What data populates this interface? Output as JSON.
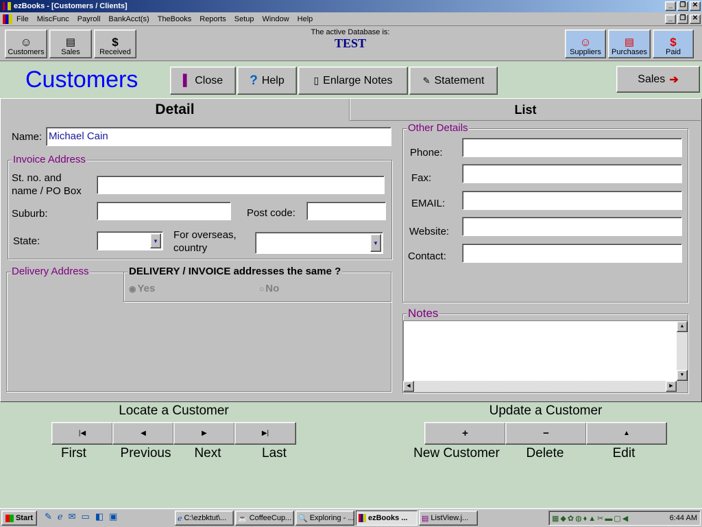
{
  "window": {
    "title": "ezBooks - [Customers / Clients]"
  },
  "menu": [
    "File",
    "MiscFunc",
    "Payroll",
    "BankAcct(s)",
    "TheBooks",
    "Reports",
    "Setup",
    "Window",
    "Help"
  ],
  "toolbar": {
    "left": [
      {
        "label": "Customers",
        "icon": "smiley-icon"
      },
      {
        "label": "Sales",
        "icon": "pages-icon"
      },
      {
        "label": "Received",
        "icon": "dollar-icon"
      }
    ],
    "db_label": "The active Database is:",
    "db_name": "TEST",
    "right": [
      {
        "label": "Suppliers",
        "icon": "smiley-icon"
      },
      {
        "label": "Purchases",
        "icon": "pages-icon"
      },
      {
        "label": "Paid",
        "icon": "dollar-icon"
      }
    ]
  },
  "header": {
    "title": "Customers",
    "close": "Close",
    "help": "Help",
    "enlarge": "Enlarge Notes",
    "statement": "Statement",
    "sales": "Sales"
  },
  "tabs": {
    "detail": "Detail",
    "list": "List"
  },
  "form": {
    "name_label": "Name:",
    "name_value": "Michael Cain",
    "invoice_title": "Invoice Address",
    "street_label_1": "St. no. and",
    "street_label_2": "name / PO Box",
    "suburb_label": "Suburb:",
    "postcode_label": "Post code:",
    "state_label": "State:",
    "overseas_label_1": "For overseas,",
    "overseas_label_2": "country",
    "delivery_title": "Delivery Address",
    "same_question": "DELIVERY / INVOICE addresses the same ?",
    "yes": "Yes",
    "no": "No",
    "other_title": "Other Details",
    "phone_label": "Phone:",
    "fax_label": "Fax:",
    "email_label": "EMAIL:",
    "website_label": "Website:",
    "contact_label": "Contact:",
    "notes_title": "Notes"
  },
  "locate": {
    "title": "Locate a Customer",
    "first": "First",
    "previous": "Previous",
    "next": "Next",
    "last": "Last"
  },
  "update": {
    "title": "Update a Customer",
    "new": "New Customer",
    "delete": "Delete",
    "edit": "Edit"
  },
  "taskbar": {
    "start": "Start",
    "tasks": [
      "C:\\ezbktut\\...",
      "CoffeeCup...",
      "Exploring - ...",
      "ezBooks ...",
      "ListView.j..."
    ],
    "active_task": 3,
    "clock": "6:44 AM"
  },
  "colors": {
    "title_bar_start": "#0a246a",
    "title_bar_end": "#a6caf0",
    "form_bg": "#c4d8c4",
    "title_blue": "#0000ff",
    "group_purple": "#800080",
    "db_name_blue": "#00008b"
  }
}
